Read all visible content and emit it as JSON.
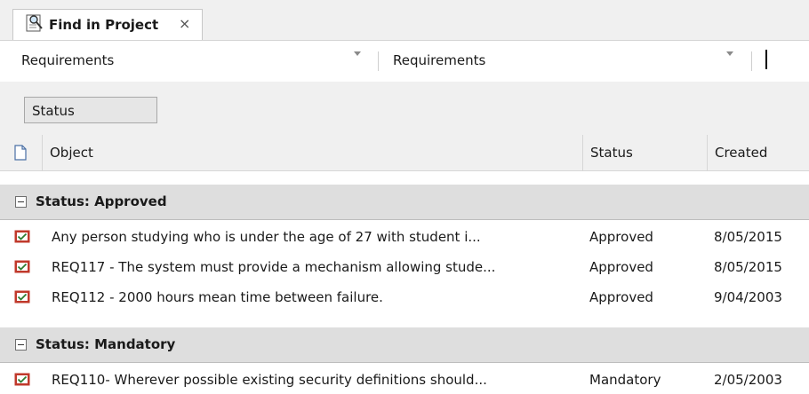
{
  "tab": {
    "label": "Find in Project",
    "close": "×"
  },
  "filters": {
    "left": {
      "value": "Requirements"
    },
    "right": {
      "value": "Requirements"
    }
  },
  "grouping": {
    "chip": "Status"
  },
  "columns": {
    "object": "Object",
    "status": "Status",
    "created": "Created"
  },
  "groups": [
    {
      "label": "Status: Approved",
      "rows": [
        {
          "object": "Any person studying who is under the age of 27 with student i...",
          "status": "Approved",
          "created": "8/05/2015"
        },
        {
          "object": "REQ117 - The system must provide a mechanism allowing stude...",
          "status": "Approved",
          "created": "8/05/2015"
        },
        {
          "object": "REQ112 - 2000 hours mean time between failure.",
          "status": "Approved",
          "created": "9/04/2003"
        }
      ]
    },
    {
      "label": "Status: Mandatory",
      "rows": [
        {
          "object": "REQ110- Wherever possible existing security definitions should...",
          "status": "Mandatory",
          "created": "2/05/2003"
        }
      ]
    }
  ],
  "icons": {
    "tab": "find-in-project-icon",
    "column": "document-icon",
    "row": "requirement-icon",
    "group_toggle": "collapse-icon"
  },
  "colors": {
    "group_band": "#dedede",
    "header": "#f0f0f0",
    "requirement_icon": "#c0392b"
  }
}
